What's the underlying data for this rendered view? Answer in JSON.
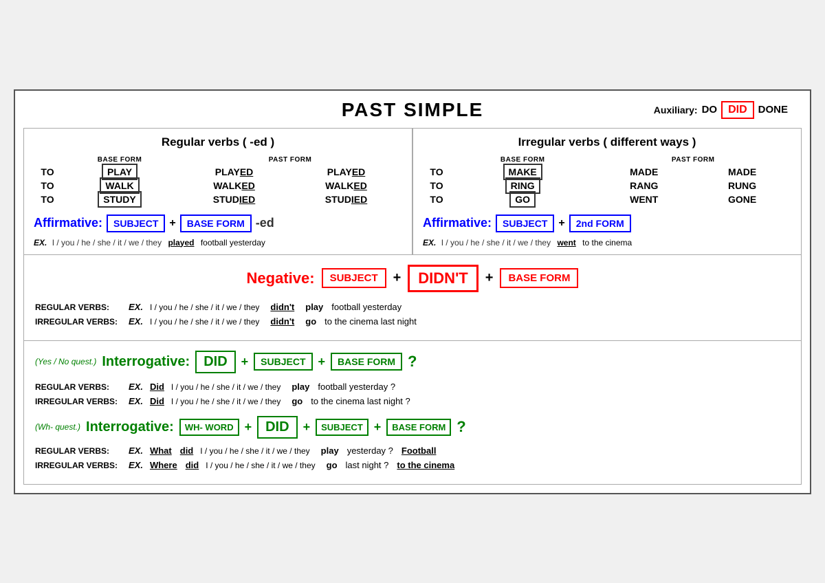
{
  "title": "PAST SIMPLE",
  "auxiliary": {
    "label": "Auxiliary:",
    "do": "DO",
    "did": "DID",
    "done": "DONE"
  },
  "regular_verbs": {
    "header": "Regular verbs ( -ed )",
    "base_form_header": "BASE FORM",
    "past_form_header": "PAST FORM",
    "rows": [
      {
        "to": "TO",
        "base": "PLAY",
        "past1": "PLAYED",
        "past2": "PLAYED",
        "ed_underline": "ED"
      },
      {
        "to": "TO",
        "base": "WALK",
        "past1": "WALKED",
        "past2": "WALKED",
        "ed_underline": "ED"
      },
      {
        "to": "TO",
        "base": "STUDY",
        "past1": "STUDIED",
        "past2": "STUDIED",
        "ed_underline": "IED"
      }
    ],
    "affirmative_label": "Affirmative:",
    "subject_box": "SUBJECT",
    "base_form_box": "BASE FORM",
    "suffix": "-ed",
    "example_label": "EX.",
    "subjects": "I / you / he / she / it / we / they",
    "key_verb": "played",
    "complement": "football yesterday"
  },
  "irregular_verbs": {
    "header": "Irregular verbs  ( different ways )",
    "base_form_header": "BASE FORM",
    "past_form_header": "PAST FORM",
    "rows": [
      {
        "to": "TO",
        "base": "MAKE",
        "past1": "MADE",
        "past2": "MADE"
      },
      {
        "to": "TO",
        "base": "RING",
        "past1": "RANG",
        "past2": "RUNG"
      },
      {
        "to": "TO",
        "base": "GO",
        "past1": "WENT",
        "past2": "GONE"
      }
    ],
    "affirmative_label": "Affirmative:",
    "subject_box": "SUBJECT",
    "form_box": "2nd FORM",
    "example_label": "EX.",
    "subjects": "I / you / he / she / it / we / they",
    "key_verb": "went",
    "complement": "to the cinema"
  },
  "negative": {
    "label": "Negative:",
    "subject_box": "SUBJECT",
    "didnt_box": "DIDN'T",
    "base_form_box": "BASE FORM",
    "plus": "+",
    "regular": {
      "type_label": "REGULAR VERBS:",
      "ex_label": "EX.",
      "subjects": "I / you / he / she / it / we / they",
      "key_verb": "didn't",
      "base_verb": "play",
      "complement": "football yesterday"
    },
    "irregular": {
      "type_label": "IRREGULAR VERBS:",
      "ex_label": "EX.",
      "subjects": "I / you / he / she / it / we / they",
      "key_verb": "didn't",
      "base_verb": "go",
      "complement": "to the cinema last night"
    }
  },
  "interrogative_yes_no": {
    "tag": "(Yes / No quest.)",
    "label": "Interrogative:",
    "did_box": "DID",
    "subject_box": "SUBJECT",
    "base_form_box": "BASE FORM",
    "plus": "+",
    "question_mark": "?",
    "regular": {
      "type_label": "REGULAR VERBS:",
      "ex_label": "EX.",
      "did_word": "Did",
      "subjects": "I / you / he / she / it / we / they",
      "base_verb": "play",
      "complement": "football yesterday ?"
    },
    "irregular": {
      "type_label": "IRREGULAR VERBS:",
      "ex_label": "EX.",
      "did_word": "Did",
      "subjects": "I / you / he / she / it / we / they",
      "base_verb": "go",
      "complement": "to the cinema last night ?"
    }
  },
  "interrogative_wh": {
    "tag": "(Wh- quest.)",
    "label": "Interrogative:",
    "wh_word_box": "WH- WORD",
    "did_box": "DID",
    "subject_box": "SUBJECT",
    "base_form_box": "BASE FORM",
    "plus": "+",
    "question_mark": "?",
    "regular": {
      "type_label": "REGULAR VERBS:",
      "ex_label": "EX.",
      "wh_word": "What",
      "did_word": "did",
      "subjects": "I / you / he / she / it / we / they",
      "base_verb": "play",
      "complement": "yesterday ?",
      "extra": "Football"
    },
    "irregular": {
      "type_label": "IRREGULAR VERBS:",
      "ex_label": "EX.",
      "wh_word": "Where",
      "did_word": "did",
      "subjects": "I / you / he / she / it / we / they",
      "base_verb": "go",
      "complement": "last night ?",
      "extra": "to the cinema"
    }
  }
}
